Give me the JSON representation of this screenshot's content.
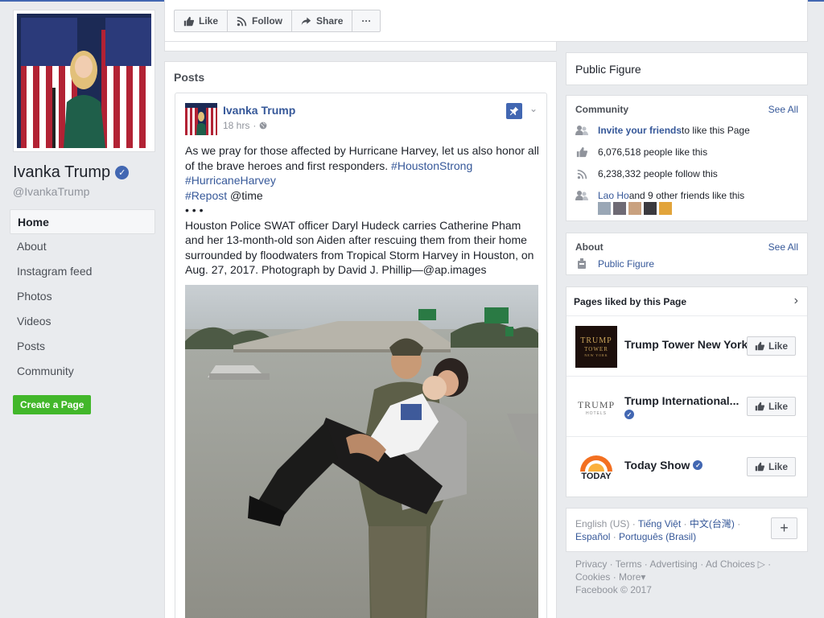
{
  "profile": {
    "name": "Ivanka Trump",
    "handle": "@IvankaTrump",
    "verified_icon": "verified-badge-icon"
  },
  "nav": {
    "items": [
      {
        "label": "Home",
        "active": true
      },
      {
        "label": "About"
      },
      {
        "label": "Instagram feed"
      },
      {
        "label": "Photos"
      },
      {
        "label": "Videos"
      },
      {
        "label": "Posts"
      },
      {
        "label": "Community"
      }
    ],
    "create_page": "Create a Page"
  },
  "actions": {
    "like": "Like",
    "follow": "Follow",
    "share": "Share",
    "more": "···"
  },
  "posts": {
    "title": "Posts",
    "post": {
      "author": "Ivanka Trump",
      "time": "18 hrs",
      "privacy_icon": "globe-icon",
      "pinned_icon": "pin-icon",
      "text_line1_a": "As we pray for those affected by Hurricane Harvey, let us also honor all of the brave heroes and first responders. ",
      "hashtag1": "#HoustonStrong",
      "hashtag2": "#HurricaneHarvey",
      "hashtag3": "#Repost",
      "mention": " @time",
      "dots": "• • •",
      "caption": "Houston Police SWAT officer Daryl Hudeck carries Catherine Pham and her 13-month-old son Aiden after rescuing them from their home surrounded by floodwaters from Tropical Storm Harvey in Houston, on Aug. 27, 2017. Photograph by David J. Phillip—@ap.images"
    }
  },
  "right": {
    "category": "Public Figure",
    "community": {
      "title": "Community",
      "see_all": "See All",
      "invite_link": "Invite your friends",
      "invite_rest": " to like this Page",
      "likes": "6,076,518 people like this",
      "follows": "6,238,332 people follow this",
      "friend_link": "Lao Ho",
      "friend_rest": " and 9 other friends like this"
    },
    "about": {
      "title": "About",
      "see_all": "See All",
      "category": "Public Figure"
    },
    "liked": {
      "title": "Pages liked by this Page",
      "items": [
        {
          "name": "Trump Tower New York",
          "logo_line1": "TRUMP",
          "logo_line2": "TOWER",
          "logo_line3": "NEW YORK",
          "like": "Like"
        },
        {
          "name": "Trump International...",
          "logo_line1": "TRUMP",
          "logo_line2": "HOTELS",
          "like": "Like"
        },
        {
          "name": "Today Show",
          "logo_text": "TODAY",
          "like": "Like"
        }
      ]
    },
    "languages": {
      "current": "English (US)",
      "l1": "Tiếng Việt",
      "l2": "中文(台灣)",
      "l3": "Español",
      "l4": "Português (Brasil)",
      "plus": "+"
    },
    "footer": {
      "privacy": "Privacy",
      "terms": "Terms",
      "advertising": "Advertising",
      "ad_choices": "Ad Choices",
      "cookies": "Cookies",
      "more": "More",
      "copyright": "Facebook © 2017"
    }
  },
  "colors": {
    "link": "#365899",
    "brand": "#4267b2",
    "create_green": "#42b72a"
  }
}
